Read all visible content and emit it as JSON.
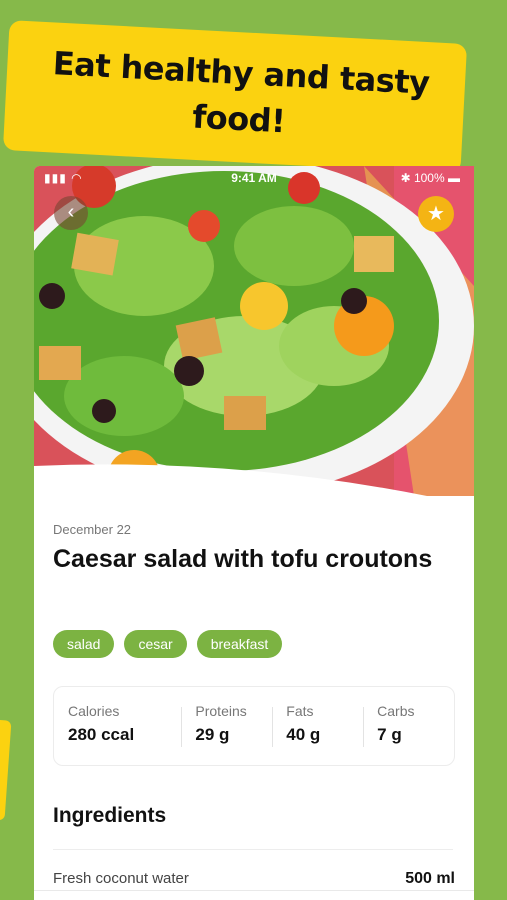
{
  "banner": {
    "headline": "Eat healthy and tasty food!"
  },
  "status_bar": {
    "time": "9:41 AM",
    "battery": "100%"
  },
  "recipe": {
    "date": "December 22",
    "title": "Caesar salad with tofu croutons",
    "tags": [
      "salad",
      "cesar",
      "breakfast"
    ]
  },
  "nutrition": [
    {
      "label": "Calories",
      "value": "280 ccal"
    },
    {
      "label": "Proteins",
      "value": "29 g"
    },
    {
      "label": "Fats",
      "value": "40 g"
    },
    {
      "label": "Carbs",
      "value": "7 g"
    }
  ],
  "ingredients": {
    "heading": "Ingredients",
    "items": [
      {
        "name": "Fresh coconut water",
        "qty": "500 ml"
      }
    ]
  },
  "icons": {
    "back": "chevron-left-icon",
    "favorite": "star-icon"
  },
  "colors": {
    "background": "#86b94a",
    "banner": "#fbd210",
    "tag": "#7cb342",
    "favorite": "#f4b414"
  }
}
